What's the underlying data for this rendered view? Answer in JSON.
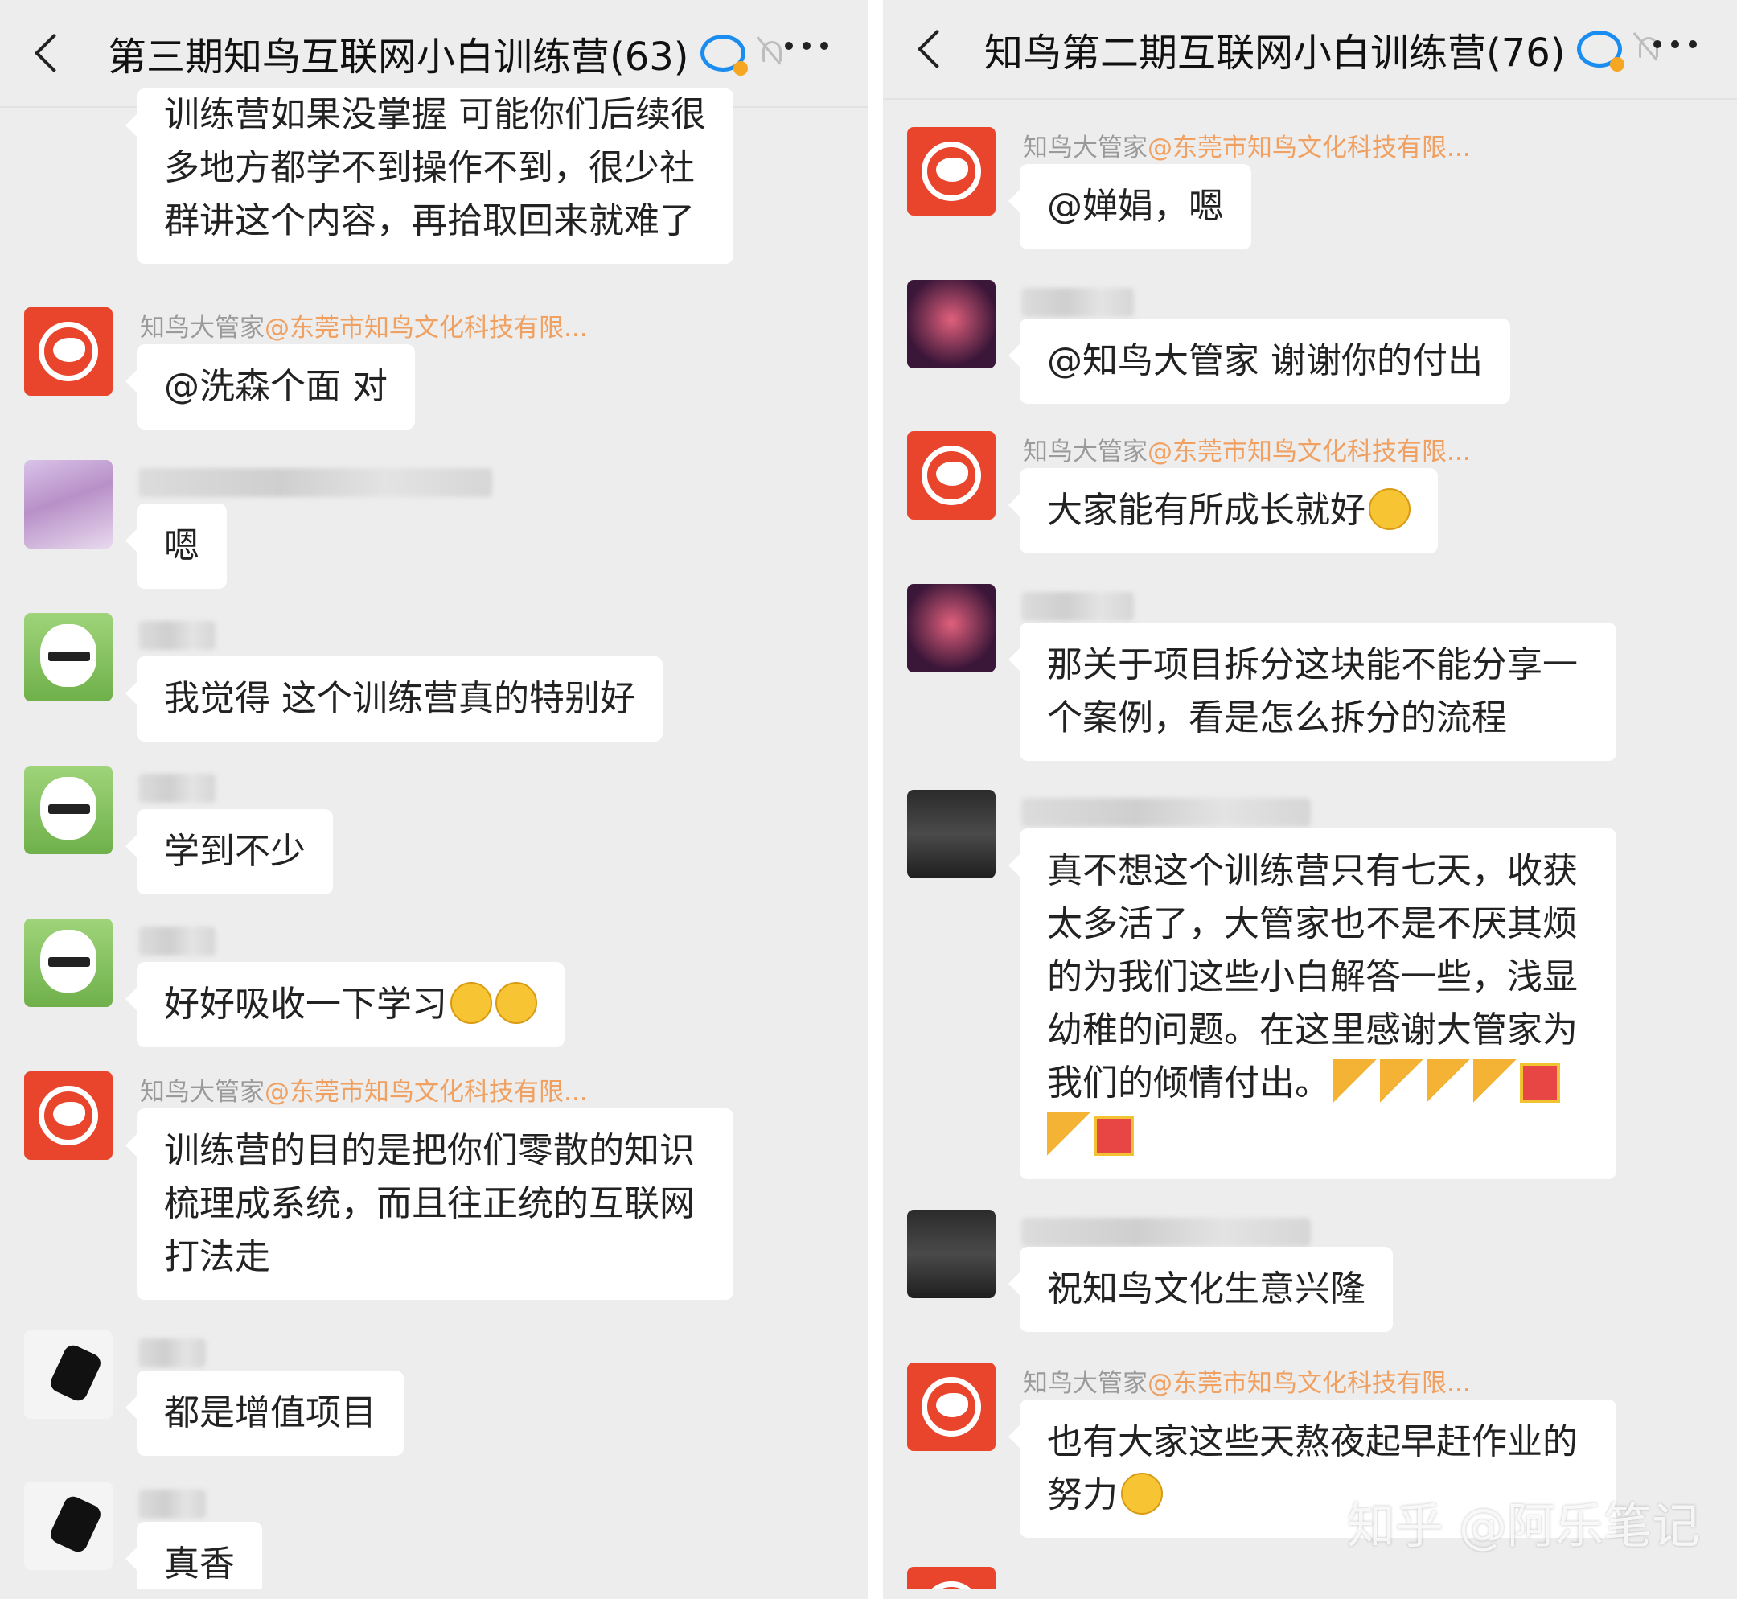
{
  "left": {
    "title": "第三期知鸟互联网小白训练营(63)",
    "msg0": [
      "训练营如果没掌握 可能你们后续很",
      "多地方都学不到操作不到，很少社",
      "群讲这个内容，再拾取回来就难了"
    ],
    "admin_name": "知鸟大管家",
    "admin_org": "@东莞市知鸟文化科技有限...",
    "msg1": "@洗森个面 对",
    "msg2": "嗯",
    "msg3": "我觉得 这个训练营真的特别好",
    "msg4": "学到不少",
    "msg5": "好好吸收一下学习",
    "msg6": [
      "训练营的目的是把你们零散的知识",
      "梳理成系统，而且往正统的互联网",
      "打法走"
    ],
    "msg7": "都是增值项目",
    "msg8": "真香"
  },
  "right": {
    "title": "知鸟第二期互联网小白训练营(76)",
    "admin_name": "知鸟大管家",
    "admin_org": "@东莞市知鸟文化科技有限...",
    "msg1": "@婵娟，嗯",
    "msg2": "@知鸟大管家  谢谢你的付出",
    "msg3": "大家能有所成长就好",
    "msg4": [
      "那关于项目拆分这块能不能分享一",
      "个案例，看是怎么拆分的流程"
    ],
    "msg5": [
      "真不想这个训练营只有七天，收获",
      "太多活了，大管家也不是不厌其烦",
      "的为我们这些小白解答一些，浅显",
      "幼稚的问题。在这里感谢大管家为",
      "我们的倾情付出。"
    ],
    "msg6": "祝知鸟文化生意兴隆",
    "msg7": [
      "也有大家这些天熬夜起早赶作业的",
      "努力"
    ]
  },
  "watermark": "知乎 @阿乐笔记",
  "icons": {
    "back": "chevron-left-icon",
    "group": "group-chat-icon",
    "mute": "bell-muted-icon",
    "more": "more-dots-icon"
  }
}
